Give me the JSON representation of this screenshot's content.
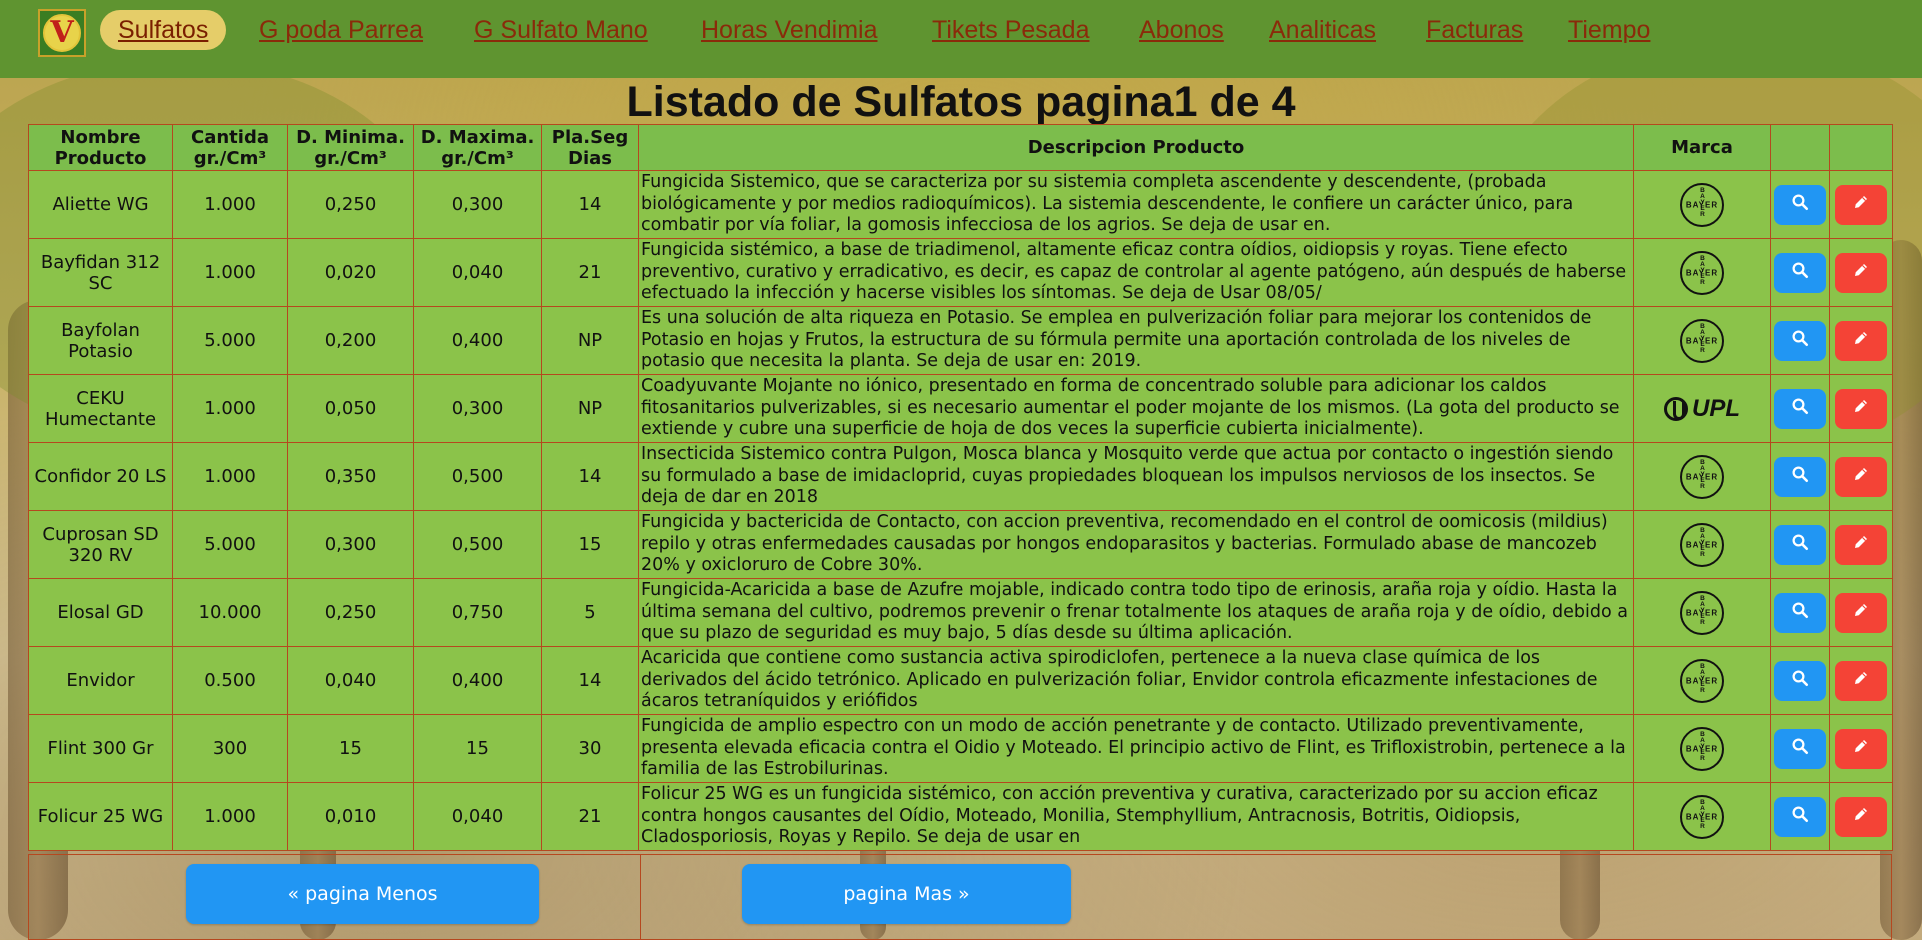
{
  "nav": {
    "logo_letter": "V",
    "links": [
      {
        "label": "Sulfatos",
        "active": true
      },
      {
        "label": "G poda Parrea"
      },
      {
        "label": "G Sulfato Mano"
      },
      {
        "label": "Horas Vendimia"
      },
      {
        "label": "Tikets Pesada"
      },
      {
        "label": "Abonos"
      },
      {
        "label": "Analiticas"
      },
      {
        "label": "Facturas"
      },
      {
        "label": "Tiempo"
      }
    ]
  },
  "page_title": "Listado de Sulfatos pagina1 de 4",
  "table": {
    "headers": {
      "nombre_l1": "Nombre",
      "nombre_l2": "Producto",
      "cantida_l1": "Cantida",
      "cantida_l2": "gr./Cm³",
      "dmin_l1": "D. Minima.",
      "dmin_l2": "gr./Cm³",
      "dmax_l1": "D. Maxima.",
      "dmax_l2": "gr./Cm³",
      "plaseg_l1": "Pla.Seg",
      "plaseg_l2": "Dias",
      "descripcion": "Descripcion Producto",
      "marca": "Marca"
    },
    "rows": [
      {
        "nombre": "Aliette WG",
        "cantidad": "1.000",
        "dmin": "0,250",
        "dmax": "0,300",
        "plazo": "14",
        "marca": "bayer",
        "descripcion": "Fungicida Sistemico, que se caracteriza por su sistemia completa ascendente y descendente, (probada biológicamente y por medios radioquímicos). La sistemia descendente, le confiere un carácter único, para combatir por vía foliar, la gomosis infecciosa de los agrios. Se deja de usar en."
      },
      {
        "nombre": "Bayfidan 312 SC",
        "cantidad": "1.000",
        "dmin": "0,020",
        "dmax": "0,040",
        "plazo": "21",
        "marca": "bayer",
        "descripcion": "Fungicida sistémico, a base de triadimenol, altamente eficaz contra oídios, oidiopsis y royas. Tiene efecto preventivo, curativo y erradicativo, es decir, es capaz de controlar al agente patógeno, aún después de haberse efectuado la infección y hacerse visibles los síntomas. Se deja de Usar 08/05/"
      },
      {
        "nombre": "Bayfolan Potasio",
        "cantidad": "5.000",
        "dmin": "0,200",
        "dmax": "0,400",
        "plazo": "NP",
        "marca": "bayer",
        "descripcion": "Es una solución de alta riqueza en Potasio. Se emplea en pulverización foliar para mejorar los contenidos de Potasio en hojas y Frutos, la estructura de su fórmula permite una aportación controlada de los niveles de potasio que necesita la planta. Se deja de usar en: 2019."
      },
      {
        "nombre": "CEKU Humectante",
        "cantidad": "1.000",
        "dmin": "0,050",
        "dmax": "0,300",
        "plazo": "NP",
        "marca": "upl",
        "descripcion": "Coadyuvante Mojante no iónico, presentado en forma de concentrado soluble para adicionar los caldos fitosanitarios pulverizables, si es necesario aumentar el poder mojante de los mismos. (La gota del producto se extiende y cubre una superficie de hoja de dos veces la superficie cubierta inicialmente)."
      },
      {
        "nombre": "Confidor 20 LS",
        "cantidad": "1.000",
        "dmin": "0,350",
        "dmax": "0,500",
        "plazo": "14",
        "marca": "bayer",
        "descripcion": "Insecticida Sistemico contra Pulgon, Mosca blanca y Mosquito verde que actua por contacto o ingestión siendo su formulado a base de imidacloprid, cuyas propiedades bloquean los impulsos nerviosos de los insectos. Se deja de dar en 2018"
      },
      {
        "nombre": "Cuprosan SD 320 RV",
        "cantidad": "5.000",
        "dmin": "0,300",
        "dmax": "0,500",
        "plazo": "15",
        "marca": "bayer",
        "descripcion": "Fungicida y bactericida de Contacto, con accion preventiva, recomendado en el control de oomicosis (mildius) repilo y otras enfermedades causadas por hongos endoparasitos y bacterias. Formulado abase de mancozeb 20% y oxicloruro de Cobre 30%."
      },
      {
        "nombre": "Elosal GD",
        "cantidad": "10.000",
        "dmin": "0,250",
        "dmax": "0,750",
        "plazo": "5",
        "marca": "bayer",
        "descripcion": "Fungicida-Acaricida a base de Azufre mojable, indicado contra todo tipo de erinosis, araña roja y oídio. Hasta la última semana del cultivo, podremos prevenir o frenar totalmente los ataques de araña roja y de oídio, debido a que su plazo de seguridad es muy bajo, 5 días desde su última aplicación."
      },
      {
        "nombre": "Envidor",
        "cantidad": "0.500",
        "dmin": "0,040",
        "dmax": "0,400",
        "plazo": "14",
        "marca": "bayer",
        "descripcion": "Acaricida que contiene como sustancia activa spirodiclofen, pertenece a la nueva clase química de los derivados del ácido tetrónico. Aplicado en pulverización foliar, Envidor controla eficazmente infestaciones de ácaros tetraníquidos y eriófidos"
      },
      {
        "nombre": "Flint 300 Gr",
        "cantidad": "300",
        "dmin": "15",
        "dmax": "15",
        "plazo": "30",
        "marca": "bayer",
        "descripcion": "Fungicida de amplio espectro con un modo de acción penetrante y de contacto. Utilizado preventivamente, presenta elevada eficacia contra el Oidio y Moteado. El principio activo de Flint, es Trifloxistrobin, pertenece a la familia de las Estrobilurinas."
      },
      {
        "nombre": "Folicur 25 WG",
        "cantidad": "1.000",
        "dmin": "0,010",
        "dmax": "0,040",
        "plazo": "21",
        "marca": "bayer",
        "descripcion": "Folicur 25 WG es un fungicida sistémico, con acción preventiva y curativa, caracterizado por su accion eficaz contra hongos causantes del Oídio, Moteado, Monilia, Stemphyllium, Antracnosis, Botritis, Oidiopsis, Cladosporiosis, Royas y Repilo. Se deja de usar en"
      }
    ]
  },
  "brands": {
    "bayer": "BAYER",
    "upl": "UPL"
  },
  "pagination": {
    "prev_label": "« pagina Menos",
    "next_label": "pagina Mas »"
  },
  "colors": {
    "nav_bg": "#5f9430",
    "row_bg": "#8bc34a",
    "border": "#b5481f",
    "view_btn": "#2196f3",
    "edit_btn": "#f44336"
  },
  "icons": {
    "view": "search-icon",
    "edit": "pencil-icon"
  }
}
